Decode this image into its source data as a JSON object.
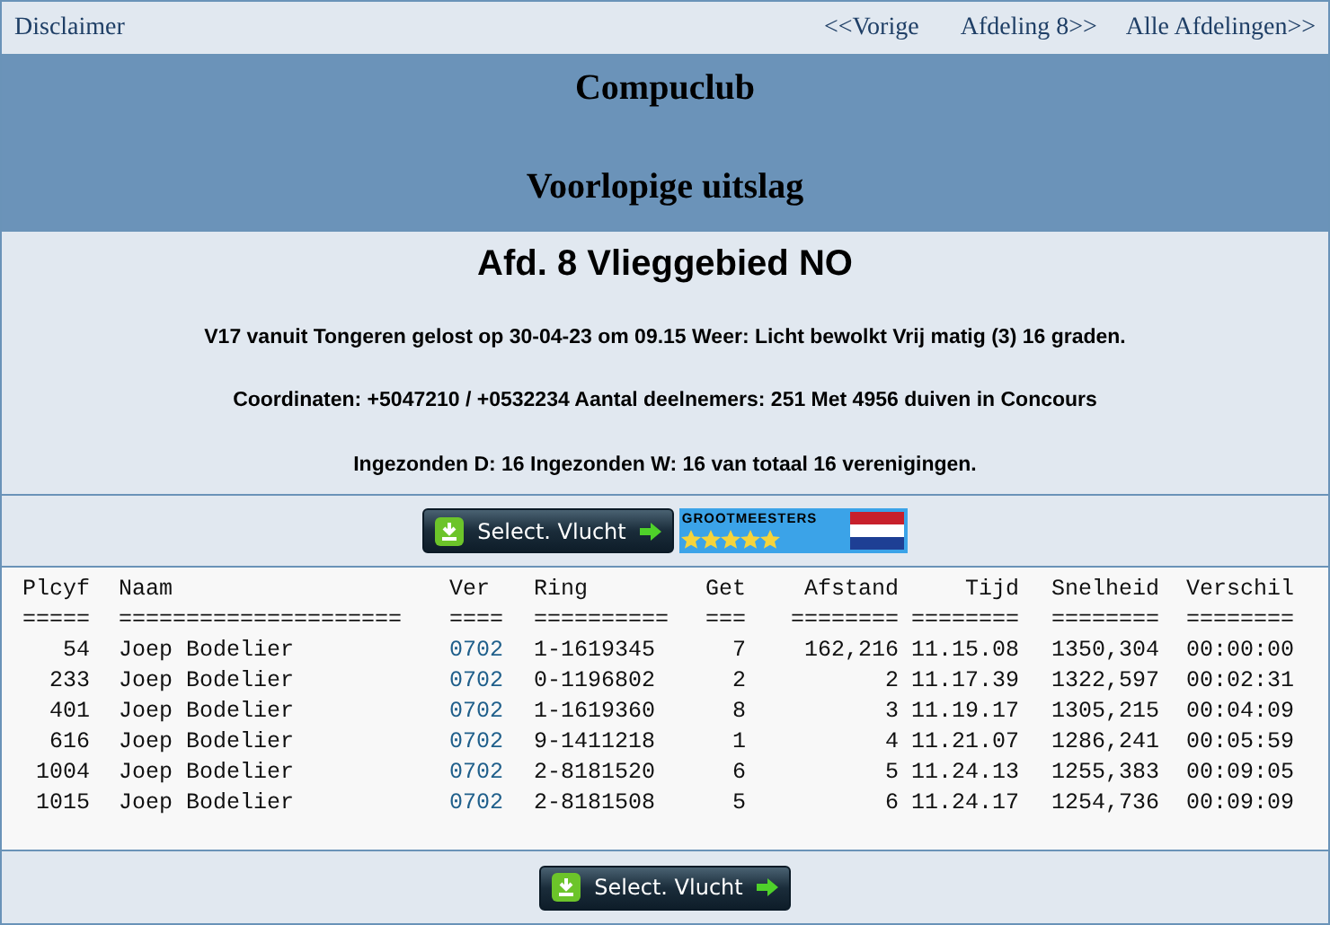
{
  "nav": {
    "disclaimer": "Disclaimer",
    "links": [
      "<<Vorige",
      "Afdeling 8>>",
      "Alle Afdelingen>>"
    ]
  },
  "banner": {
    "club": "Compuclub",
    "subtitle": "Voorlopige uitslag"
  },
  "info": {
    "title": "Afd. 8 Vlieggebied NO",
    "lines": [
      "V17 vanuit Tongeren gelost op 30-04-23 om 09.15 Weer: Licht bewolkt Vrij matig (3) 16 graden.",
      "Coordinaten: +5047210 / +0532234 Aantal deelnemers: 251 Met 4956 duiven in Concours",
      "Ingezonden D: 16 Ingezonden W: 16 van totaal 16 verenigingen."
    ]
  },
  "top_buttons": {
    "select": "Select. Vlucht",
    "badge": {
      "label": "GROOTMEESTERS",
      "stars": 5
    }
  },
  "table": {
    "columns": [
      {
        "label": "Plcyf",
        "rule": "====="
      },
      {
        "label": "Naam",
        "rule": "====================="
      },
      {
        "label": "Ver",
        "rule": "===="
      },
      {
        "label": "Ring",
        "rule": "=========="
      },
      {
        "label": "Get",
        "rule": "==="
      },
      {
        "label": "Afstand",
        "rule": "========"
      },
      {
        "label": "Tijd",
        "rule": "========"
      },
      {
        "label": "Snelheid",
        "rule": "========"
      },
      {
        "label": "Verschil",
        "rule": "========"
      }
    ],
    "rows": [
      [
        "54",
        "Joep Bodelier",
        "0702",
        "1-1619345",
        "7",
        "162,216",
        "11.15.08",
        "1350,304",
        "00:00:00"
      ],
      [
        "233",
        "Joep Bodelier",
        "0702",
        "0-1196802",
        "2",
        "2",
        "11.17.39",
        "1322,597",
        "00:02:31"
      ],
      [
        "401",
        "Joep Bodelier",
        "0702",
        "1-1619360",
        "8",
        "3",
        "11.19.17",
        "1305,215",
        "00:04:09"
      ],
      [
        "616",
        "Joep Bodelier",
        "0702",
        "9-1411218",
        "1",
        "4",
        "11.21.07",
        "1286,241",
        "00:05:59"
      ],
      [
        "1004",
        "Joep Bodelier",
        "0702",
        "2-8181520",
        "6",
        "5",
        "11.24.13",
        "1255,383",
        "00:09:05"
      ],
      [
        "1015",
        "Joep Bodelier",
        "0702",
        "2-8181508",
        "5",
        "6",
        "11.24.17",
        "1254,736",
        "00:09:09"
      ]
    ]
  },
  "bottom_button": "Select. Vlucht"
}
